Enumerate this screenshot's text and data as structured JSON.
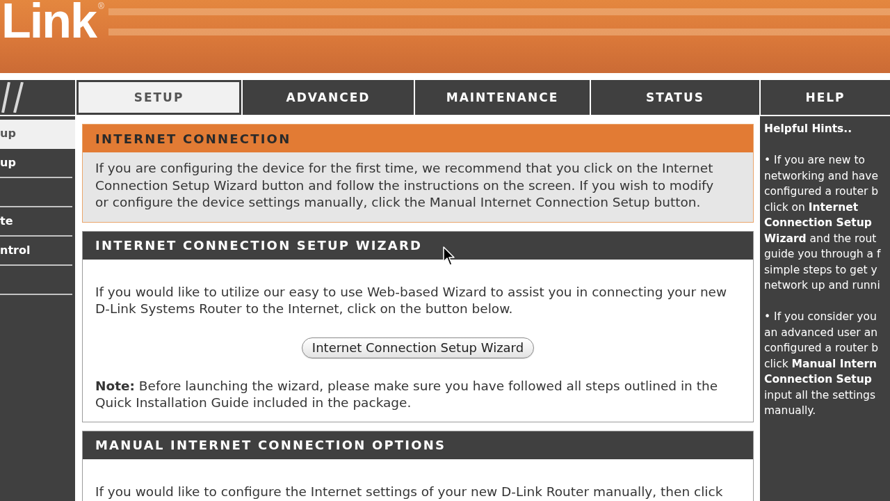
{
  "header": {
    "logo": "Link",
    "trademark": "®"
  },
  "nav": {
    "tabs": [
      {
        "label": "SETUP",
        "selected": true
      },
      {
        "label": "ADVANCED",
        "selected": false
      },
      {
        "label": "MAINTENANCE",
        "selected": false
      },
      {
        "label": "STATUS",
        "selected": false
      },
      {
        "label": "HELP",
        "selected": false
      }
    ]
  },
  "sidebar": {
    "items": [
      {
        "kind": "link",
        "label": "up",
        "selected": true
      },
      {
        "kind": "link",
        "label": "up",
        "selected": false
      },
      {
        "kind": "blank"
      },
      {
        "kind": "link",
        "label": "te",
        "selected": false
      },
      {
        "kind": "link",
        "label": "ntrol",
        "selected": false
      },
      {
        "kind": "blank"
      }
    ]
  },
  "sections": [
    {
      "kind": "highlight",
      "title": "INTERNET CONNECTION",
      "blocks": [
        {
          "kind": "paragraph",
          "text": "If you are configuring the device for the first time, we recommend that you click on the Internet Connection Setup Wizard button and follow the instructions on the screen. If you wish to modify or configure the device settings manually, click the Manual Internet Connection Setup button."
        }
      ]
    },
    {
      "kind": "standard",
      "title": "INTERNET CONNECTION SETUP WIZARD",
      "blocks": [
        {
          "kind": "paragraph",
          "text": "If you would like to utilize our easy to use Web-based Wizard to assist you in connecting your new D-Link Systems Router to the Internet, click on the button below."
        },
        {
          "kind": "button",
          "label": "Internet Connection Setup Wizard"
        },
        {
          "kind": "paragraph",
          "text": "**Note:** Before launching the wizard, please make sure you have followed all steps outlined in the Quick Installation Guide included in the package."
        }
      ]
    },
    {
      "kind": "standard",
      "title": "MANUAL INTERNET CONNECTION OPTIONS",
      "blocks": [
        {
          "kind": "paragraph",
          "text": "If you would like to configure the Internet settings of your new D-Link Router manually, then click"
        }
      ]
    }
  ],
  "hints": {
    "title": "Helpful Hints..",
    "items": [
      {
        "lines": [
          "• If you are new to",
          "networking and have",
          "configured a router b",
          "click on **Internet**",
          "**Connection Setup**",
          "**Wizard** and the rout",
          "guide you through a f",
          "simple steps to get y",
          "network up and runni"
        ]
      },
      {
        "lines": [
          "• If you consider you",
          "an advanced user an",
          "configured a router b",
          "click **Manual Intern**",
          "**Connection Setup**",
          "input all the settings",
          "manually."
        ]
      }
    ]
  }
}
